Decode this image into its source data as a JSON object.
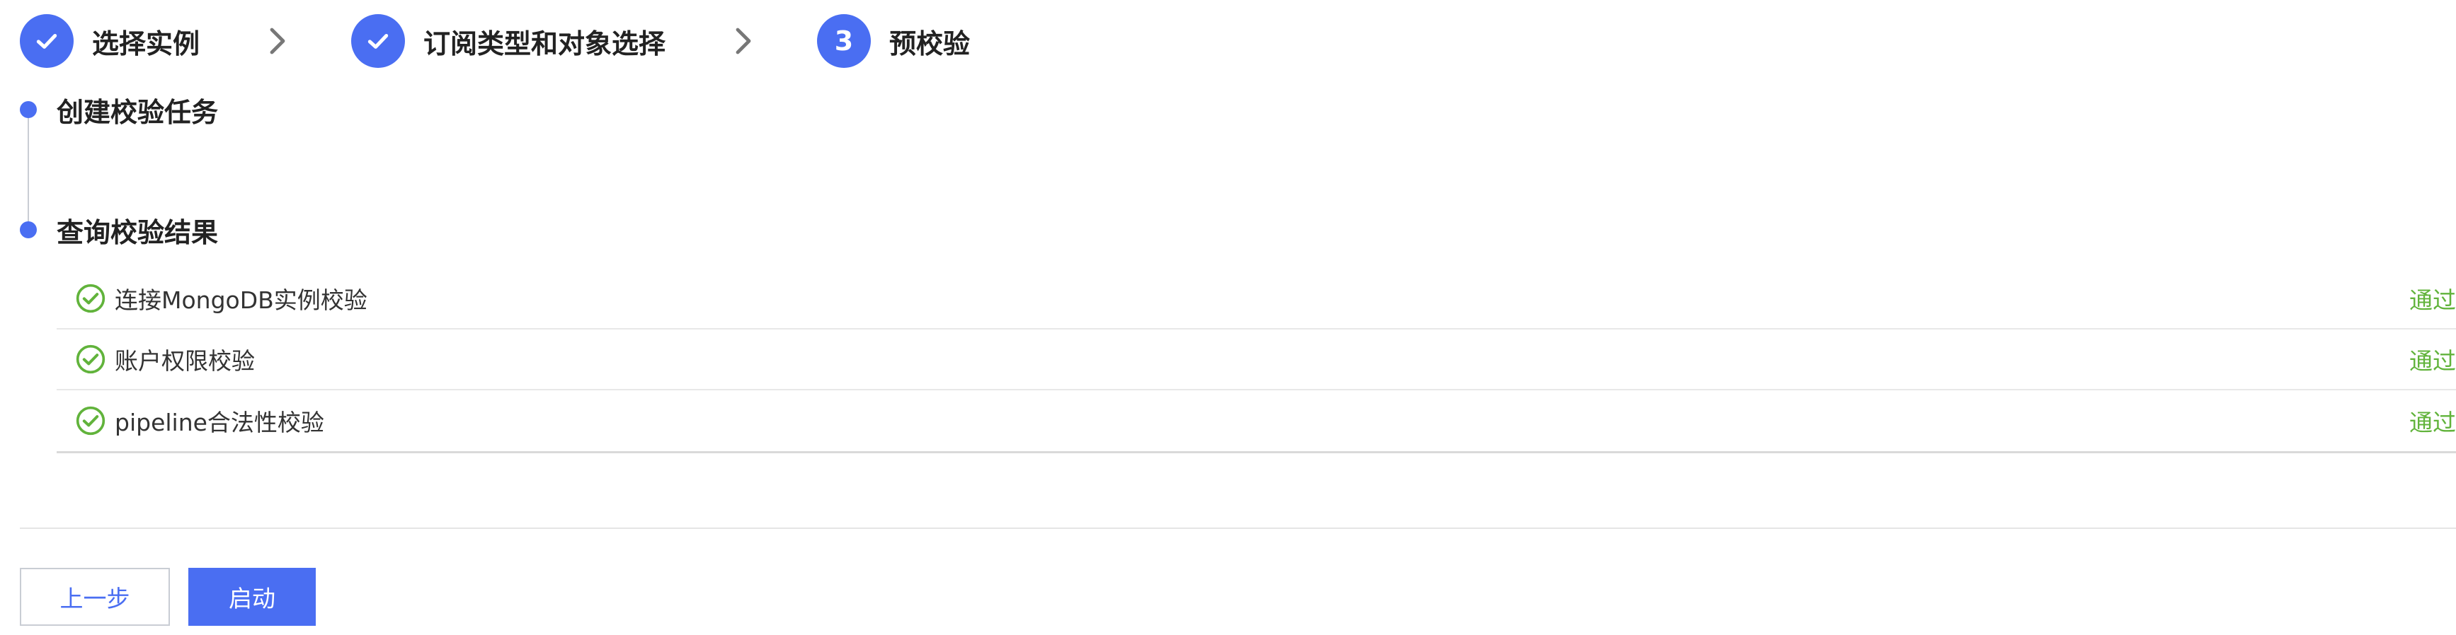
{
  "stepper": {
    "steps": [
      {
        "label": "选择实例",
        "state": "done",
        "icon": "check-icon"
      },
      {
        "label": "订阅类型和对象选择",
        "state": "done",
        "icon": "check-icon"
      },
      {
        "label": "预校验",
        "state": "current",
        "number": "3"
      }
    ],
    "separator_icon": "chevron-right-icon"
  },
  "timeline": {
    "create_task_title": "创建校验任务",
    "query_result_title": "查询校验结果"
  },
  "checks": [
    {
      "name": "连接MongoDB实例校验",
      "status": "通过",
      "icon": "success-circle-icon"
    },
    {
      "name": "账户权限校验",
      "status": "通过",
      "icon": "success-circle-icon"
    },
    {
      "name": "pipeline合法性校验",
      "status": "通过",
      "icon": "success-circle-icon"
    }
  ],
  "footer": {
    "prev_label": "上一步",
    "start_label": "启动"
  },
  "colors": {
    "primary": "#4a6ef2",
    "success": "#61b33b",
    "text": "#222222"
  }
}
